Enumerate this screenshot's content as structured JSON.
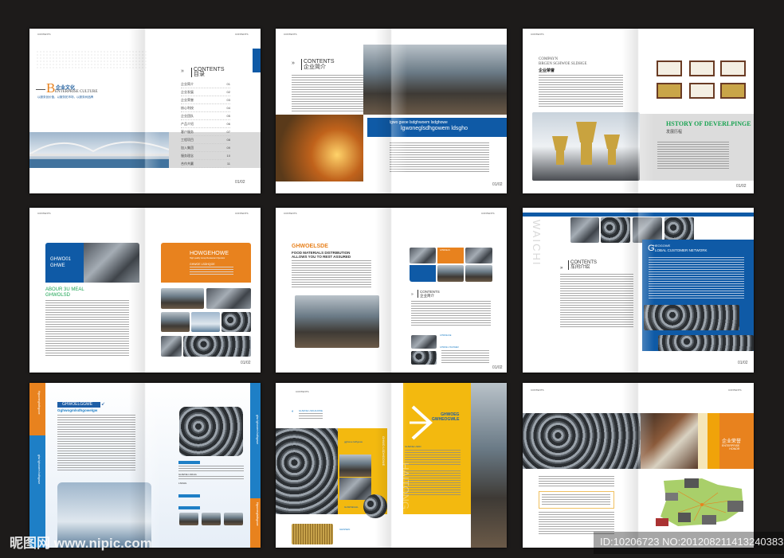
{
  "header_mark": "CONTENTS",
  "page_number": "01/02",
  "spreads": {
    "s1": {
      "culture_letter": "B",
      "culture_cn": "企业文化",
      "culture_en": "ENTERPRISE CULTURE",
      "culture_sub": "以服务创价值，以服务拓市场，以服务树品牌",
      "contents_title": "CONTENTS",
      "contents_cn": "目录",
      "toc": [
        {
          "label": "企业简介",
          "page": "01"
        },
        {
          "label": "企业发展",
          "page": "02"
        },
        {
          "label": "企业荣誉",
          "page": "03"
        },
        {
          "label": "核心利校",
          "page": "04"
        },
        {
          "label": "企业团队",
          "page": "05"
        },
        {
          "label": "产品介绍",
          "page": "06"
        },
        {
          "label": "客户服务",
          "page": "07"
        },
        {
          "label": "工程项目",
          "page": "08"
        },
        {
          "label": "加入集团",
          "page": "09"
        },
        {
          "label": "服务理念",
          "page": "10"
        },
        {
          "label": "合作共赢",
          "page": "11"
        }
      ]
    },
    "s2": {
      "contents_title": "CONTENTS",
      "contents_cn": "企业简介",
      "band_line1": "lgwo gwoe lsdghwoem lsdghowe",
      "band_line2": "lgwoneglsdhgowem ldsgho"
    },
    "s3": {
      "title_line1": "COMPAYN",
      "title_line2": "BRGEN SGHWOE SLDHGE",
      "title_cn": "企业荣誉",
      "history_title": "HSTORY OF DEVERLPINGE",
      "history_cn": "发展历程"
    },
    "s4": {
      "blue_box_line1": "GHWO01",
      "blue_box_line2": "GHWE",
      "green_line1": "ABOUR 3U MEAL",
      "green_line2": "GHWOLSD",
      "orange_title": "HOWGEHOWE",
      "orange_sub": "High quality Group Restaurant Operator",
      "orange_heading": "GHWOE LSDHQOE"
    },
    "s5": {
      "orange_title": "GHWOELSDE",
      "subtitle_line1": "FOOD MATERIALS DISTRIBUTION",
      "subtitle_line2": "ALLOWS YOU TO REST ASSURED",
      "tile_label": "GHWOELS",
      "contents_title": "CONTENTS",
      "contents_cn": "企业简介",
      "item1": "GHWOELSE",
      "item2": "GHWOE LHGOWEM"
    },
    "s6": {
      "vertical_word": "WAICHI",
      "contents_title": "CONTENTS",
      "contents_cn": "车间介绍",
      "panel_big_letter": "G",
      "panel_line1": "HEOGOWE",
      "panel_line2": "LOBAL CUSTOMER NETWORK"
    },
    "s7": {
      "side_orange": "Hgwoneglsdhgowe",
      "side_blue": "ghw lghwoem lsdhgowe",
      "label": "GHWOELGGWE",
      "subtitle": "Gghwogmlsdhgowelgw",
      "item1": "GHWOE LSDHG",
      "item2": "LSDHG",
      "right_side_blue": "ghw lghwoem lsdhgowe",
      "right_side_orange": "Hgwoneglsdhgowe"
    },
    "s8": {
      "item_top": "GHWOE LSDHGOWE",
      "item_yellow": "gghwoe lsdfgowe",
      "item_bottom": "GHWOEGHL",
      "item_last": "GEWSEN",
      "vertical": "GHWO LSDHGOWE",
      "watermark_word": "HAITONG",
      "panel_line1": "GHWOEG",
      "panel_line2": "GWHEOGWLE",
      "panel_heading": "GHWOE LSDD"
    },
    "s9": {
      "honor_cn": "企业荣誉",
      "honor_en_line1": "ENTERPRISE",
      "honor_en_line2": "HONOR"
    }
  },
  "watermark": {
    "left": "昵图网 www.nipic.com",
    "right": "ID:10206723 NO:20120821141324038321"
  },
  "colors": {
    "blue": "#0f5aa6",
    "orange": "#e8821e",
    "green": "#1aa352",
    "yellow": "#f3b90f",
    "bg": "#1d1b1a"
  }
}
